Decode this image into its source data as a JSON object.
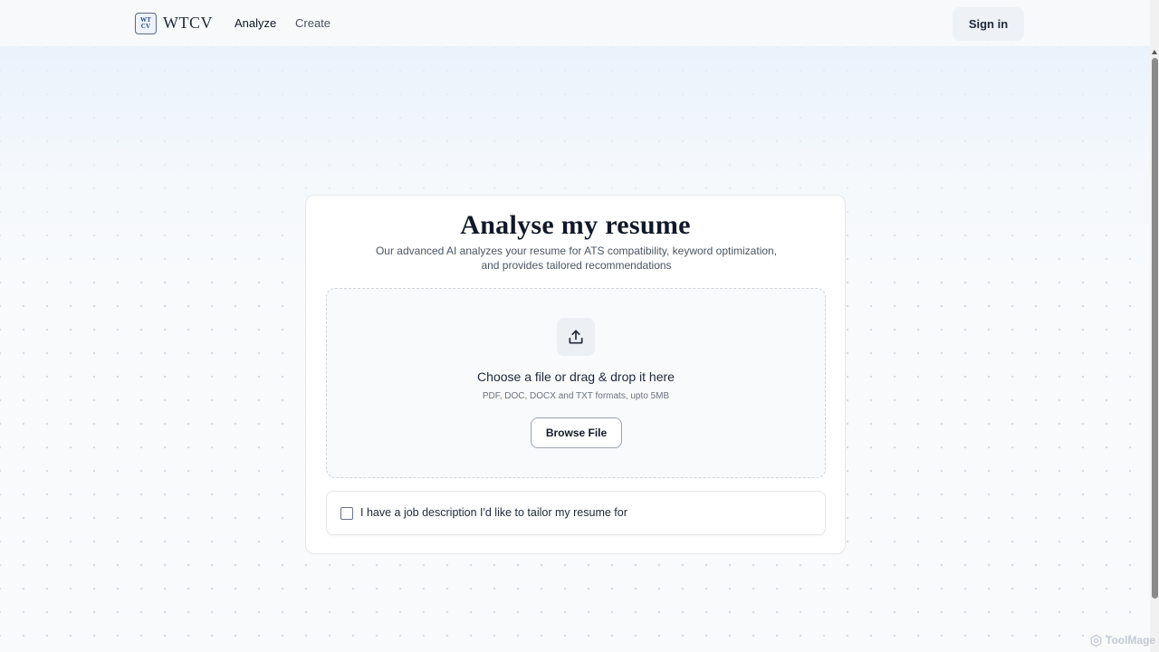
{
  "header": {
    "logo_mark_top": "WT",
    "logo_mark_bottom": "CV",
    "logo_text": "WTCV",
    "nav": [
      {
        "label": "Analyze"
      },
      {
        "label": "Create"
      }
    ],
    "signin_label": "Sign in"
  },
  "card": {
    "title": "Analyse my resume",
    "subtitle_line1": "Our advanced AI analyzes your resume for ATS compatibility, keyword optimization,",
    "subtitle_line2": "and provides tailored recommendations",
    "dropzone": {
      "icon": "upload-icon",
      "title": "Choose a file or drag & drop it here",
      "hint": "PDF, DOC, DOCX and TXT formats, upto 5MB",
      "browse_label": "Browse File"
    },
    "job_description": {
      "checked": false,
      "label": "I have a job description I'd like to tailor my resume for"
    }
  },
  "watermark": {
    "text": "ToolMage",
    "icon": "watermark-logo-icon"
  },
  "colors": {
    "background": "#f8fafc",
    "card_bg": "#ffffff",
    "button_secondary": "#eef1f5",
    "text_primary": "#111827",
    "text_muted": "#4b5563"
  }
}
